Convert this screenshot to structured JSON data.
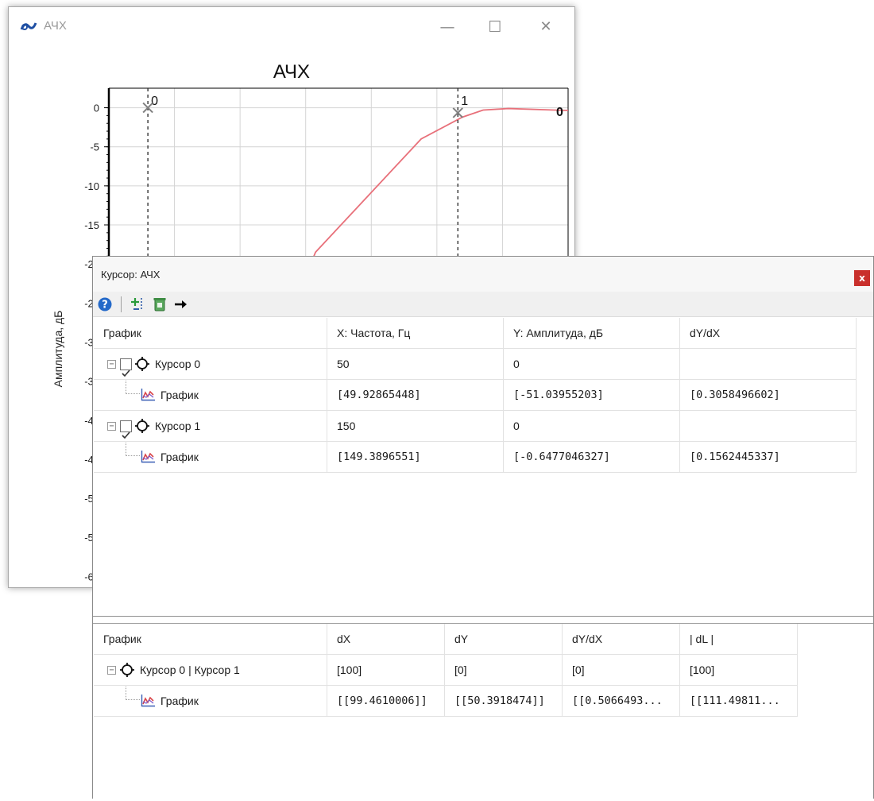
{
  "chart_window": {
    "title": "АЧХ",
    "controls": {
      "minimize": "—",
      "maximize": "☐",
      "close": "✕"
    },
    "chart_title": "АЧХ",
    "y_axis_label": "Амплитуда, дБ"
  },
  "chart_data": {
    "type": "line",
    "title": "АЧХ",
    "xlabel": "",
    "ylabel": "Амплитуда, дБ",
    "y_ticks_visible": [
      "0",
      "-5",
      "-10",
      "-15",
      "-20",
      "-25",
      "-30",
      "-35",
      "-40",
      "-45",
      "-50",
      "-55",
      "-60"
    ],
    "ylim": [
      -62,
      2.5
    ],
    "grid": true,
    "line_color": "#e8707a",
    "series": [
      {
        "points": [
          [
            0.3,
            -40.0
          ],
          [
            0.45,
            -18.5
          ],
          [
            0.68,
            -4.0
          ],
          [
            0.77,
            -1.2
          ],
          [
            0.815,
            -0.3
          ],
          [
            0.87,
            -0.1
          ],
          [
            0.97,
            -0.3
          ],
          [
            1.0,
            -0.35
          ]
        ]
      }
    ],
    "cursors": [
      {
        "label": "0",
        "x": 0.085,
        "y": 0.0,
        "label_end": "0"
      },
      {
        "label": "1",
        "x": 0.76,
        "y": -0.65
      }
    ]
  },
  "cursor_window": {
    "title": "Курсор: АЧХ",
    "close": "x",
    "toolbar_icons": [
      "help-icon",
      "add-cursor-icon",
      "delete-cursor-icon",
      "arrow-right-icon"
    ],
    "top_table": {
      "headers": [
        "График",
        "X: Частота, Гц",
        "Y: Амплитуда, дБ",
        "dY/dX"
      ],
      "rows": [
        {
          "level": 0,
          "expander": "−",
          "checked": true,
          "icon": "crosshair",
          "name": "Курсор 0",
          "x": "50",
          "y": "0",
          "dydx": ""
        },
        {
          "level": 1,
          "icon": "graph",
          "name": "График",
          "x": "[49.92865448]",
          "y": "[-51.03955203]",
          "dydx": "[0.3058496602]"
        },
        {
          "level": 0,
          "expander": "−",
          "checked": true,
          "icon": "crosshair",
          "name": "Курсор 1",
          "x": "150",
          "y": "0",
          "dydx": ""
        },
        {
          "level": 1,
          "icon": "graph",
          "name": "График",
          "x": "[149.3896551]",
          "y": "[-0.6477046327]",
          "dydx": "[0.1562445337]"
        }
      ]
    },
    "bottom_table": {
      "headers": [
        "График",
        "dX",
        "dY",
        "dY/dX",
        "| dL |"
      ],
      "rows": [
        {
          "level": 0,
          "expander": "−",
          "icon": "crosshair",
          "name": "Курсор 0 | Курсор 1",
          "dx": "[100]",
          "dy": "[0]",
          "dydx": "[0]",
          "dl": "[100]"
        },
        {
          "level": 1,
          "icon": "graph",
          "name": "График",
          "dx": "[[99.4610006]]",
          "dy": "[[50.3918474]]",
          "dydx": "[[0.5066493...",
          "dl": "[[111.49811..."
        }
      ]
    }
  }
}
